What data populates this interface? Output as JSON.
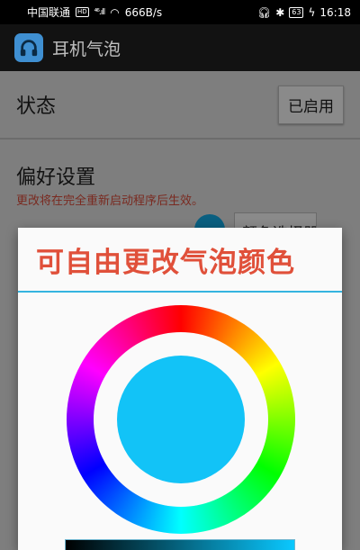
{
  "status_bar": {
    "carrier": "中国联通",
    "badge": "HD",
    "network": "⁴⁶.ıll",
    "speed": "666B/s",
    "battery": "63",
    "time": "16:18"
  },
  "app_bar": {
    "title": "耳机气泡"
  },
  "settings": {
    "status_label": "状态",
    "status_button": "已启用",
    "preferences_title": "偏好设置",
    "preferences_note": "更改将在完全重新启动程序后生效。",
    "color_picker_button": "颜色选择器"
  },
  "dialog": {
    "title": "可自由更改气泡颜色",
    "selected_color": "#12c3f7"
  },
  "colors": {
    "accent_line": "#35b4e0",
    "title_color": "#e0503a"
  }
}
